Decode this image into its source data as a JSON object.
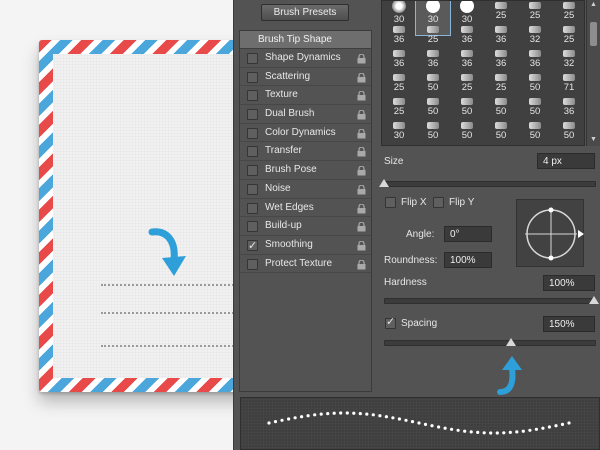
{
  "panel": {
    "brush_presets_label": "Brush Presets",
    "brush_tip_shape": "Brush Tip Shape",
    "options": [
      {
        "label": "Shape Dynamics",
        "checked": false
      },
      {
        "label": "Scattering",
        "checked": false
      },
      {
        "label": "Texture",
        "checked": false
      },
      {
        "label": "Dual Brush",
        "checked": false
      },
      {
        "label": "Color Dynamics",
        "checked": false
      },
      {
        "label": "Transfer",
        "checked": false
      },
      {
        "label": "Brush Pose",
        "checked": false
      },
      {
        "label": "Noise",
        "checked": false
      },
      {
        "label": "Wet Edges",
        "checked": false
      },
      {
        "label": "Build-up",
        "checked": false
      },
      {
        "label": "Smoothing",
        "checked": true
      },
      {
        "label": "Protect Texture",
        "checked": false
      }
    ],
    "brush_grid": [
      [
        "30",
        "30",
        "30",
        "25",
        "25",
        "25"
      ],
      [
        "36",
        "25",
        "36",
        "36",
        "32",
        "25"
      ],
      [
        "36",
        "36",
        "36",
        "36",
        "36",
        "32"
      ],
      [
        "25",
        "50",
        "25",
        "25",
        "50",
        "71"
      ],
      [
        "25",
        "50",
        "50",
        "50",
        "50",
        "36"
      ],
      [
        "30",
        "50",
        "50",
        "50",
        "50",
        "50"
      ]
    ],
    "selected_brush_index": 1,
    "size_label": "Size",
    "size_value": "4 px",
    "flip_x_label": "Flip X",
    "flip_y_label": "Flip Y",
    "angle_label": "Angle:",
    "angle_value": "0°",
    "roundness_label": "Roundness:",
    "roundness_value": "100%",
    "hardness_label": "Hardness",
    "hardness_value": "100%",
    "spacing_label": "Spacing",
    "spacing_value": "150%",
    "spacing_checked": true,
    "size_slider_fraction": 0.0,
    "hardness_slider_fraction": 1.0,
    "spacing_slider_fraction": 0.6
  },
  "colors": {
    "panel_bg": "#535353",
    "accent_blue": "#2e9fd8",
    "stripe_red": "#e84a4a",
    "stripe_blue": "#4aa6db"
  },
  "icons": [
    "lock-icon",
    "curved-arrow-icon",
    "angle-crosshair-icon",
    "chevron-up-icon",
    "chevron-down-icon"
  ]
}
